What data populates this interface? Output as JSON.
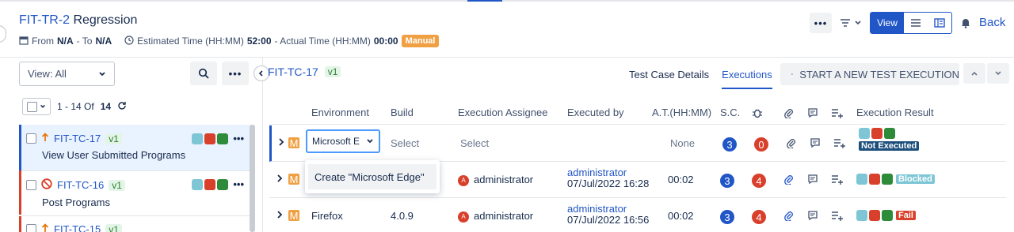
{
  "header": {
    "key": "FIT-TR-2",
    "title": "Regression",
    "from_label": "From",
    "from_value": "N/A",
    "to_label": "- To",
    "to_value": "N/A",
    "estimated_label": "Estimated Time (HH:MM)",
    "estimated_value": "52:00",
    "actual_label": "- Actual Time (HH:MM)",
    "actual_value": "00:00",
    "type_badge": "Manual",
    "more_label": "•••",
    "view_label": "View",
    "back_label": "Back"
  },
  "sidebar": {
    "view_select": "View: All",
    "more_label": "•••",
    "pager_text": "1 - 14 Of",
    "pager_total": "14",
    "items": [
      {
        "key": "FIT-TC-17",
        "version": "v1",
        "name": "View User Submitted Programs",
        "more": "•••"
      },
      {
        "key": "FIT-TC-16",
        "version": "v1",
        "name": "Post Programs",
        "more": "•••"
      },
      {
        "key": "FIT-TC-15",
        "version": "v1",
        "name": "",
        "more": ""
      }
    ]
  },
  "main": {
    "tc_key": "FIT-TC-17",
    "tc_version": "v1",
    "tabs": [
      "Test Case Details",
      "Executions"
    ],
    "start_button": "START A NEW TEST EXECUTION",
    "columns": [
      "Environment",
      "Build",
      "Execution Assignee",
      "Executed by",
      "A.T.(HH:MM)",
      "S.C.",
      "Execution Result"
    ],
    "rows": [
      {
        "env": "Microsoft E",
        "build": "Select",
        "assignee": "Select",
        "executed_by": "",
        "executed_at": "",
        "at": "None",
        "sc": "3",
        "defects": "0",
        "result": "Not Executed",
        "result_color": "#1d4f7c"
      },
      {
        "env": "",
        "build": "",
        "assignee": "administrator",
        "executed_by": "administrator",
        "executed_at": "07/Jul/2022 16:28",
        "at": "00:02",
        "sc": "3",
        "defects": "4",
        "result": "Blocked",
        "result_color": "#7ec6d6"
      },
      {
        "env": "Firefox",
        "build": "4.0.9",
        "assignee": "administrator",
        "executed_by": "administrator",
        "executed_at": "07/Jul/2022 16:56",
        "at": "00:02",
        "sc": "3",
        "defects": "4",
        "result": "Fail",
        "result_color": "#d8402b"
      }
    ],
    "avatar_letter": "A",
    "m_letter": "M",
    "dropdown_option": "Create \"Microsoft Edge\""
  },
  "colors": {
    "accent": "#2156c7",
    "manual": "#f0a043",
    "pass": "#2e8b3a",
    "fail": "#d8402b",
    "blocked": "#7ec6d6"
  }
}
